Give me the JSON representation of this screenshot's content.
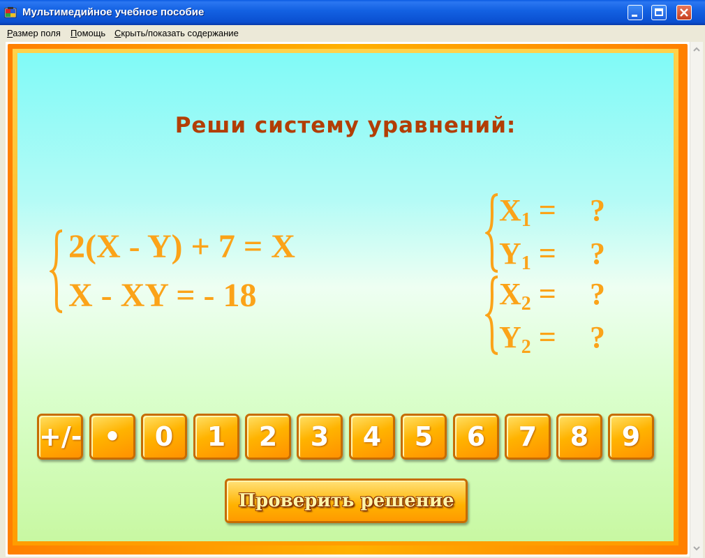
{
  "window": {
    "title": "Мультимедийное учебное пособие"
  },
  "menu": [
    {
      "label_u": "Р",
      "label_rest": "азмер поля"
    },
    {
      "label_u": "П",
      "label_rest": "омощь"
    },
    {
      "label_u": "С",
      "label_rest": "крыть/показать содержание"
    }
  ],
  "task": {
    "title": "Реши систему уравнений:",
    "equation_1": "2(X - Y) + 7 = X",
    "equation_2": "X - XY = - 18"
  },
  "answers": [
    {
      "var": "X",
      "index": "1",
      "eq": "=",
      "value": "?"
    },
    {
      "var": "Y",
      "index": "1",
      "eq": "=",
      "value": "?"
    },
    {
      "var": "X",
      "index": "2",
      "eq": "=",
      "value": "?"
    },
    {
      "var": "Y",
      "index": "2",
      "eq": "=",
      "value": "?"
    }
  ],
  "keypad": {
    "keys": [
      "+/-",
      "•",
      "0",
      "1",
      "2",
      "3",
      "4",
      "5",
      "6",
      "7",
      "8",
      "9"
    ]
  },
  "check_button": {
    "label": "Проверить решение"
  },
  "colors": {
    "accent": "#fba319",
    "title": "#b23e05",
    "frame": "#ff8c00"
  }
}
